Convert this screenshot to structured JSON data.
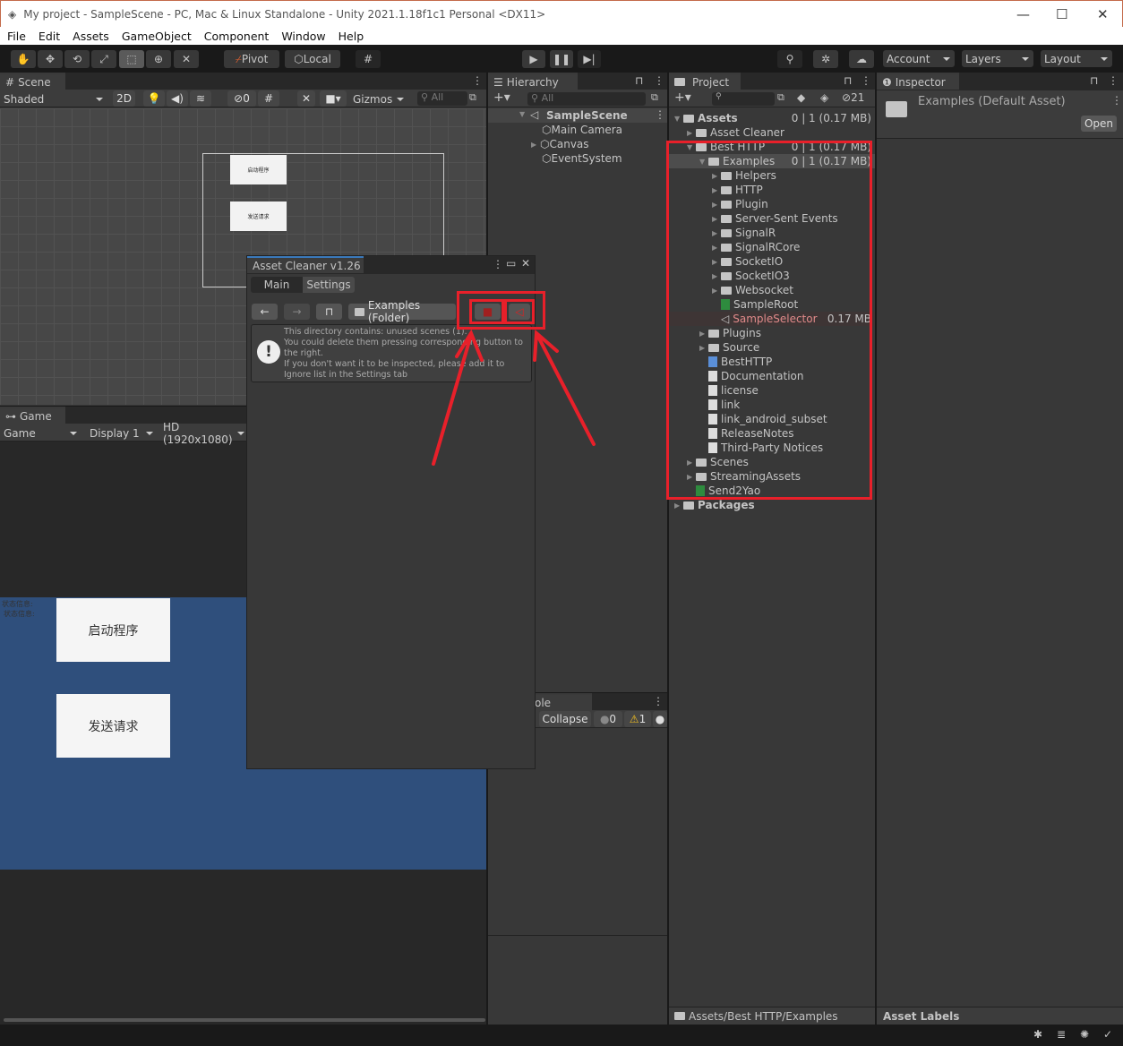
{
  "window": {
    "title": "My project - SampleScene - PC, Mac & Linux Standalone - Unity 2021.1.18f1c1 Personal <DX11>",
    "minimize": "—",
    "maximize": "☐",
    "close": "✕"
  },
  "menu": [
    "File",
    "Edit",
    "Assets",
    "GameObject",
    "Component",
    "Window",
    "Help"
  ],
  "toolbar": {
    "pivot": "Pivot",
    "local": "Local",
    "account": "Account",
    "layers": "Layers",
    "layout": "Layout"
  },
  "scene": {
    "tab": "Scene",
    "shading": "Shaded",
    "mode_2d": "2D",
    "hidden_count": "0",
    "gizmos": "Gizmos",
    "search_placeholder": "All",
    "ui_button1": "启动程序",
    "ui_button2": "发送请求"
  },
  "game": {
    "tab": "Game",
    "view": "Game",
    "display": "Display 1",
    "resolution": "HD (1920x1080)",
    "status1": "状态信息:",
    "status2": "状态信息:",
    "button1": "启动程序",
    "button2": "发送请求"
  },
  "hierarchy": {
    "tab": "Hierarchy",
    "search_placeholder": "All",
    "scene": "SampleScene",
    "items": [
      "Main Camera",
      "Canvas",
      "EventSystem"
    ]
  },
  "console": {
    "tab": "ole",
    "collapse": "Collapse",
    "info_count": "0",
    "warn_count": "1"
  },
  "project": {
    "tab": "Project",
    "hidden_count": "21",
    "path": "Assets/Best HTTP/Examples",
    "tree": [
      {
        "label": "Assets",
        "level": 0,
        "kind": "folder",
        "open": true,
        "bold": true,
        "count": "0",
        "size": "1 (0.17 MB)"
      },
      {
        "label": "Asset Cleaner",
        "level": 1,
        "kind": "folder"
      },
      {
        "label": "Best HTTP",
        "level": 1,
        "kind": "folder",
        "open": true,
        "count": "0",
        "size": "1 (0.17 MB)"
      },
      {
        "label": "Examples",
        "level": 2,
        "kind": "folder",
        "open": true,
        "selected": true,
        "count": "0",
        "size": "1 (0.17 MB)"
      },
      {
        "label": "Helpers",
        "level": 3,
        "kind": "folder"
      },
      {
        "label": "HTTP",
        "level": 3,
        "kind": "folder"
      },
      {
        "label": "Plugin",
        "level": 3,
        "kind": "folder"
      },
      {
        "label": "Server-Sent Events",
        "level": 3,
        "kind": "folder"
      },
      {
        "label": "SignalR",
        "level": 3,
        "kind": "folder"
      },
      {
        "label": "SignalRCore",
        "level": 3,
        "kind": "folder"
      },
      {
        "label": "SocketIO",
        "level": 3,
        "kind": "folder"
      },
      {
        "label": "SocketIO3",
        "level": 3,
        "kind": "folder"
      },
      {
        "label": "Websocket",
        "level": 3,
        "kind": "folder"
      },
      {
        "label": "SampleRoot",
        "level": 3,
        "kind": "script"
      },
      {
        "label": "SampleSelector",
        "level": 3,
        "kind": "scene",
        "flag": true,
        "size": "0.17 MB"
      },
      {
        "label": "Plugins",
        "level": 2,
        "kind": "folder"
      },
      {
        "label": "Source",
        "level": 2,
        "kind": "folder"
      },
      {
        "label": "BestHTTP",
        "level": 2,
        "kind": "asset"
      },
      {
        "label": "Documentation",
        "level": 2,
        "kind": "file"
      },
      {
        "label": "license",
        "level": 2,
        "kind": "file"
      },
      {
        "label": "link",
        "level": 2,
        "kind": "file"
      },
      {
        "label": "link_android_subset",
        "level": 2,
        "kind": "file"
      },
      {
        "label": "ReleaseNotes",
        "level": 2,
        "kind": "file"
      },
      {
        "label": "Third-Party Notices",
        "level": 2,
        "kind": "file"
      },
      {
        "label": "Scenes",
        "level": 1,
        "kind": "folder"
      },
      {
        "label": "StreamingAssets",
        "level": 1,
        "kind": "folder"
      },
      {
        "label": "Send2Yao",
        "level": 1,
        "kind": "script"
      },
      {
        "label": "Packages",
        "level": 0,
        "kind": "folder",
        "bold": true
      }
    ]
  },
  "inspector": {
    "tab": "Inspector",
    "title": "Examples (Default Asset)",
    "open": "Open",
    "asset_labels": "Asset Labels"
  },
  "asset_cleaner": {
    "title": "Asset Cleaner v1.26",
    "tabs": [
      "Main",
      "Settings"
    ],
    "folder": "Examples (Folder)",
    "message": [
      "This directory contains: unused scenes (1).",
      "You could delete them pressing corresponding button to",
      "the right.",
      "If you don't want it to be inspected, please add it to",
      "Ignore list in the Settings tab"
    ]
  },
  "colors": {
    "annotation": "#e8202a",
    "game_bg": "#2f4f7c",
    "flagged": "#e08a8a"
  }
}
